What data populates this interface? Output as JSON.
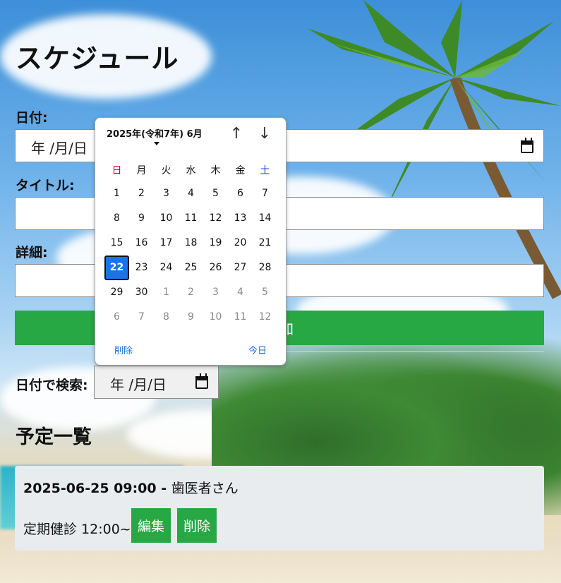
{
  "page": {
    "title": "スケジュール"
  },
  "form": {
    "date_label": "日付:",
    "date_value": "年 /月/日",
    "title_label": "タイトル:",
    "title_value": "",
    "detail_label": "詳細:",
    "detail_value": "",
    "add_button_label": "追加"
  },
  "search": {
    "label": "日付で検索:",
    "date_value": "年 /月/日"
  },
  "list": {
    "heading": "予定一覧",
    "events": [
      {
        "datetime": "2025-06-25 09:00",
        "separator": " - ",
        "title": "歯医者さん",
        "detail": "定期健診 12:00~",
        "edit_label": "編集",
        "delete_label": "削除"
      }
    ]
  },
  "picker": {
    "month_label": "2025年(令和7年) 6月",
    "prev_icon": "arrow-up-icon",
    "next_icon": "arrow-down-icon",
    "weekdays": [
      "日",
      "月",
      "火",
      "水",
      "木",
      "金",
      "土"
    ],
    "weeks": [
      [
        "1",
        "2",
        "3",
        "4",
        "5",
        "6",
        "7"
      ],
      [
        "8",
        "9",
        "10",
        "11",
        "12",
        "13",
        "14"
      ],
      [
        "15",
        "16",
        "17",
        "18",
        "19",
        "20",
        "21"
      ],
      [
        "22",
        "23",
        "24",
        "25",
        "26",
        "27",
        "28"
      ],
      [
        "29",
        "30",
        "1",
        "2",
        "3",
        "4",
        "5"
      ],
      [
        "6",
        "7",
        "8",
        "9",
        "10",
        "11",
        "12"
      ]
    ],
    "selected_day": "22",
    "clear_label": "削除",
    "today_label": "今日"
  },
  "colors": {
    "accent_green": "#28a745",
    "selected_blue": "#1a73e8",
    "sunday_red": "#d0021b",
    "saturday_blue": "#1f3ad8",
    "link_blue": "#1a6fc9"
  }
}
